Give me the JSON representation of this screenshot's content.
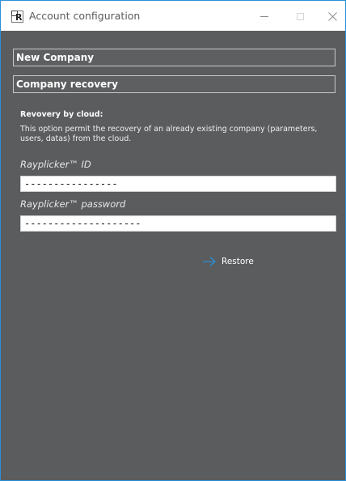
{
  "window": {
    "title": "Account configuration",
    "app_icon_letter": "R"
  },
  "sections": {
    "new_company_label": "New Company",
    "company_recovery_label": "Company recovery"
  },
  "recovery": {
    "title": "Revovery by cloud:",
    "description": "This option permit the recovery of an already existing company (parameters, users, datas) from the cloud.",
    "id_label": "Rayplicker™ ID",
    "id_value": "----------------",
    "password_label": "Rayplicker™ password",
    "password_value": "--------------------",
    "restore_label": "Restore"
  },
  "colors": {
    "accent": "#2b8fd6",
    "background": "#5a5c5d"
  },
  "icons": {
    "restore": "arrow-right-icon",
    "close": "close-icon",
    "minimize": "minimize-icon",
    "maximize": "maximize-icon"
  }
}
